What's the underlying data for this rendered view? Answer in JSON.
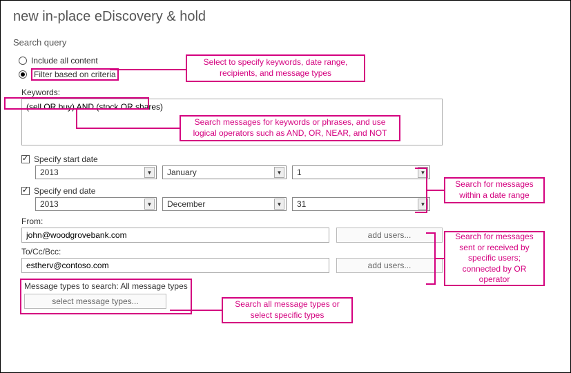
{
  "title": "new in-place eDiscovery & hold",
  "section": "Search query",
  "radios": {
    "include_all": "Include all content",
    "filter": "Filter based on criteria"
  },
  "labels": {
    "keywords": "Keywords:",
    "specify_start": "Specify start date",
    "specify_end": "Specify end date",
    "from": "From:",
    "to": "To/Cc/Bcc:",
    "msg_types": "Message types to search:  All message types"
  },
  "values": {
    "keywords": "(sell OR buy) AND (stock OR shares)",
    "start_year": "2013",
    "start_month": "January",
    "start_day": "1",
    "end_year": "2013",
    "end_month": "December",
    "end_day": "31",
    "from": "john@woodgrovebank.com",
    "to": "estherv@contoso.com"
  },
  "buttons": {
    "add_users": "add users...",
    "select_types": "select message types..."
  },
  "callouts": {
    "filter": "Select to specify keywords, date range, recipients, and message types",
    "keywords": "Search messages for keywords or phrases, and use logical operators such as AND, OR, NEAR, and NOT",
    "date": "Search for messages within a date range",
    "users": "Search for messages sent or received by specific users; connected by OR operator",
    "types": "Search all message types or select specific types"
  }
}
